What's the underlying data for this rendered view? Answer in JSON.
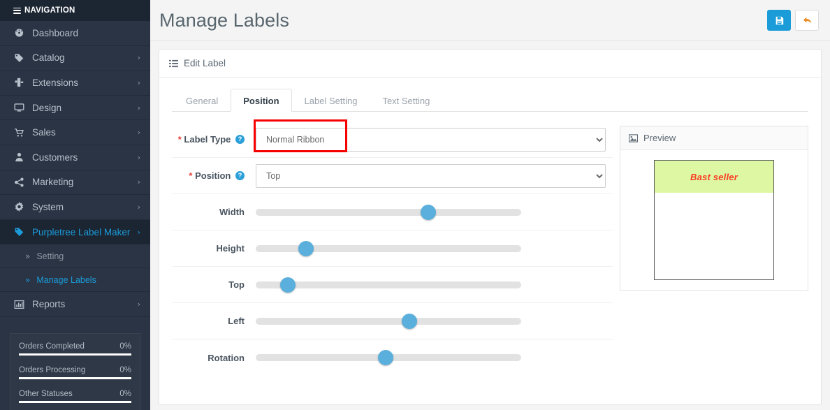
{
  "sidebar": {
    "header": "NAVIGATION",
    "items": [
      {
        "label": "Dashboard",
        "icon": "dashboard-icon",
        "caret": "",
        "active": false
      },
      {
        "label": "Catalog",
        "icon": "tag-icon",
        "caret": "›",
        "active": false
      },
      {
        "label": "Extensions",
        "icon": "puzzle-icon",
        "caret": "›",
        "active": false
      },
      {
        "label": "Design",
        "icon": "monitor-icon",
        "caret": "›",
        "active": false
      },
      {
        "label": "Sales",
        "icon": "cart-icon",
        "caret": "›",
        "active": false
      },
      {
        "label": "Customers",
        "icon": "user-icon",
        "caret": "›",
        "active": false
      },
      {
        "label": "Marketing",
        "icon": "share-icon",
        "caret": "›",
        "active": false
      },
      {
        "label": "System",
        "icon": "gear-icon",
        "caret": "›",
        "active": false
      },
      {
        "label": "Purpletree Label Maker",
        "icon": "tag-icon",
        "caret": "›",
        "active": true
      }
    ],
    "subitems": [
      {
        "label": "Setting",
        "chevron": "»",
        "active": false
      },
      {
        "label": "Manage Labels",
        "chevron": "»",
        "active": true
      }
    ],
    "after_items": [
      {
        "label": "Reports",
        "icon": "chart-icon",
        "caret": "›",
        "active": false
      }
    ],
    "stats": [
      {
        "label": "Orders Completed",
        "value": "0%",
        "percent": 100
      },
      {
        "label": "Orders Processing",
        "value": "0%",
        "percent": 100
      },
      {
        "label": "Other Statuses",
        "value": "0%",
        "percent": 100
      }
    ]
  },
  "header": {
    "title": "Manage Labels",
    "save_icon": "save-floppy-icon",
    "back_icon": "back-arrow-icon"
  },
  "panel": {
    "title": "Edit Label",
    "icon": "list-icon"
  },
  "tabs": [
    {
      "label": "General",
      "active": false
    },
    {
      "label": "Position",
      "active": true
    },
    {
      "label": "Label Setting",
      "active": false
    },
    {
      "label": "Text Setting",
      "active": false
    }
  ],
  "form": {
    "label_type": {
      "label": "Label Type",
      "required": "*",
      "help": "?",
      "value": "Normal Ribbon",
      "options": [
        "Normal Ribbon"
      ],
      "highlighted": true,
      "highlight_color": "#f70000"
    },
    "position": {
      "label": "Position",
      "required": "*",
      "help": "?",
      "value": "Top",
      "options": [
        "Top"
      ]
    },
    "sliders": [
      {
        "label": "Width",
        "percent": 65
      },
      {
        "label": "Height",
        "percent": 19
      },
      {
        "label": "Top",
        "percent": 12
      },
      {
        "label": "Left",
        "percent": 58
      },
      {
        "label": "Rotation",
        "percent": 49
      }
    ]
  },
  "preview": {
    "title": "Preview",
    "icon": "image-icon",
    "label_text": "Bast seller",
    "ribbon_color": "#ddf7a3",
    "text_color": "#fb3b23"
  }
}
